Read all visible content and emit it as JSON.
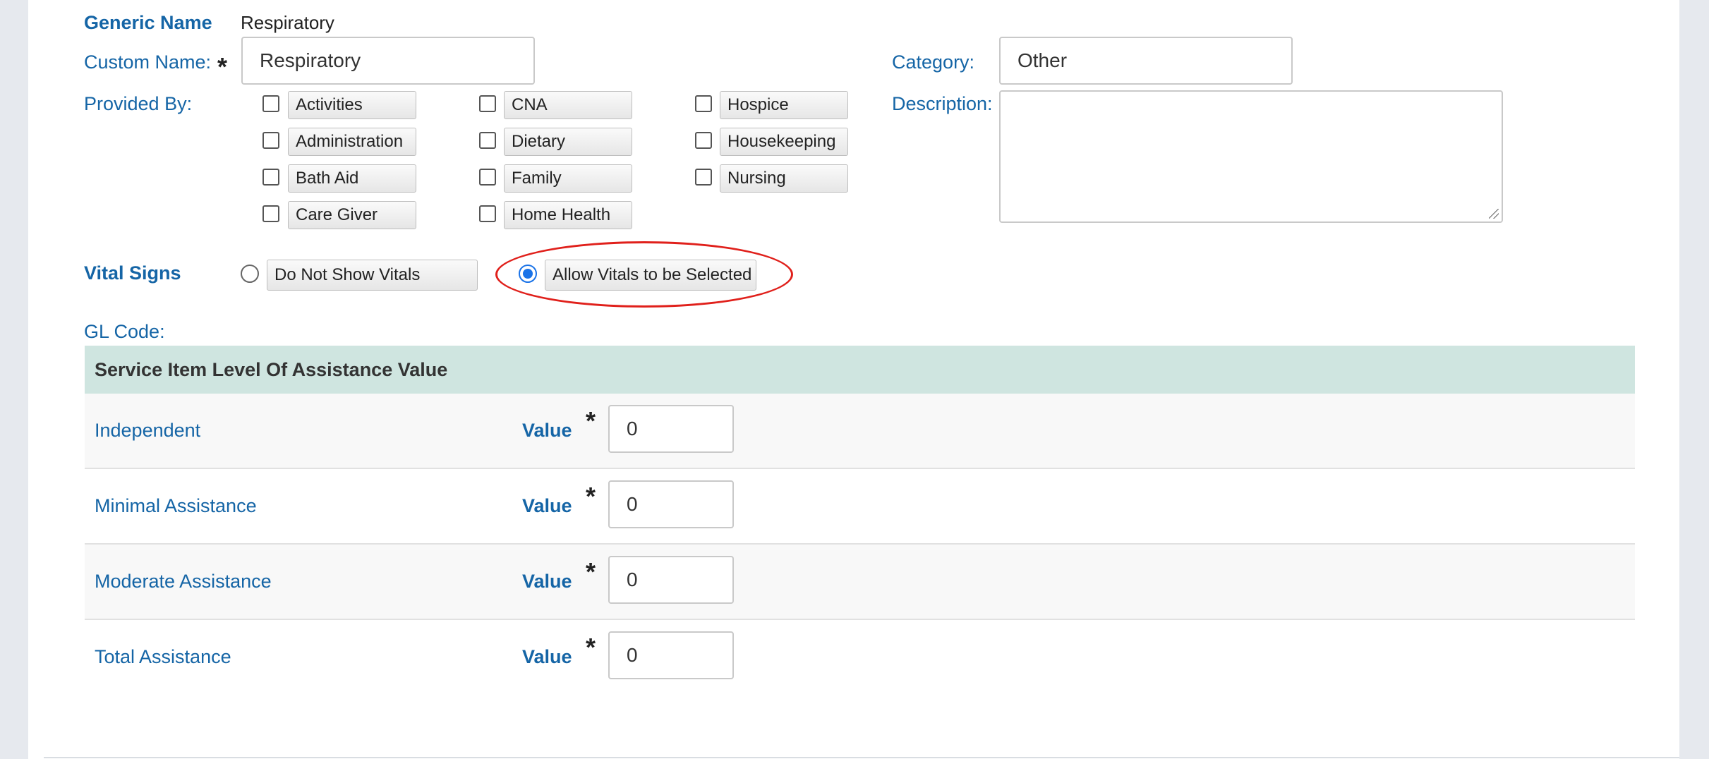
{
  "form": {
    "generic_name_label": "Generic Name",
    "generic_name_value": "Respiratory",
    "custom_name_label": "Custom Name:",
    "custom_name_value": "Respiratory",
    "required_mark": "*",
    "category_label": "Category:",
    "category_value": "Other",
    "description_label": "Description:",
    "description_value": "",
    "provided_by_label": "Provided By:",
    "provided_by_options": [
      {
        "label": "Activities",
        "checked": false
      },
      {
        "label": "Administration",
        "checked": false
      },
      {
        "label": "Bath Aid",
        "checked": false
      },
      {
        "label": "Care Giver",
        "checked": false
      },
      {
        "label": "CNA",
        "checked": false
      },
      {
        "label": "Dietary",
        "checked": false
      },
      {
        "label": "Family",
        "checked": false
      },
      {
        "label": "Home Health",
        "checked": false
      },
      {
        "label": "Hospice",
        "checked": false
      },
      {
        "label": "Housekeeping",
        "checked": false
      },
      {
        "label": "Nursing",
        "checked": false
      }
    ],
    "vital_signs_label": "Vital Signs",
    "vital_options": [
      {
        "label": "Do Not Show Vitals",
        "selected": false
      },
      {
        "label": "Allow Vitals to be Selected",
        "selected": true
      }
    ],
    "gl_code_label": "GL Code:"
  },
  "assistance_table": {
    "header": "Service Item Level Of Assistance Value",
    "value_label": "Value",
    "rows": [
      {
        "name": "Independent",
        "value": "0"
      },
      {
        "name": "Minimal Assistance",
        "value": "0"
      },
      {
        "name": "Moderate Assistance",
        "value": "0"
      },
      {
        "name": "Total Assistance",
        "value": "0"
      }
    ]
  },
  "annotation": {
    "color": "#e0201b",
    "target": "Allow Vitals to be Selected"
  }
}
